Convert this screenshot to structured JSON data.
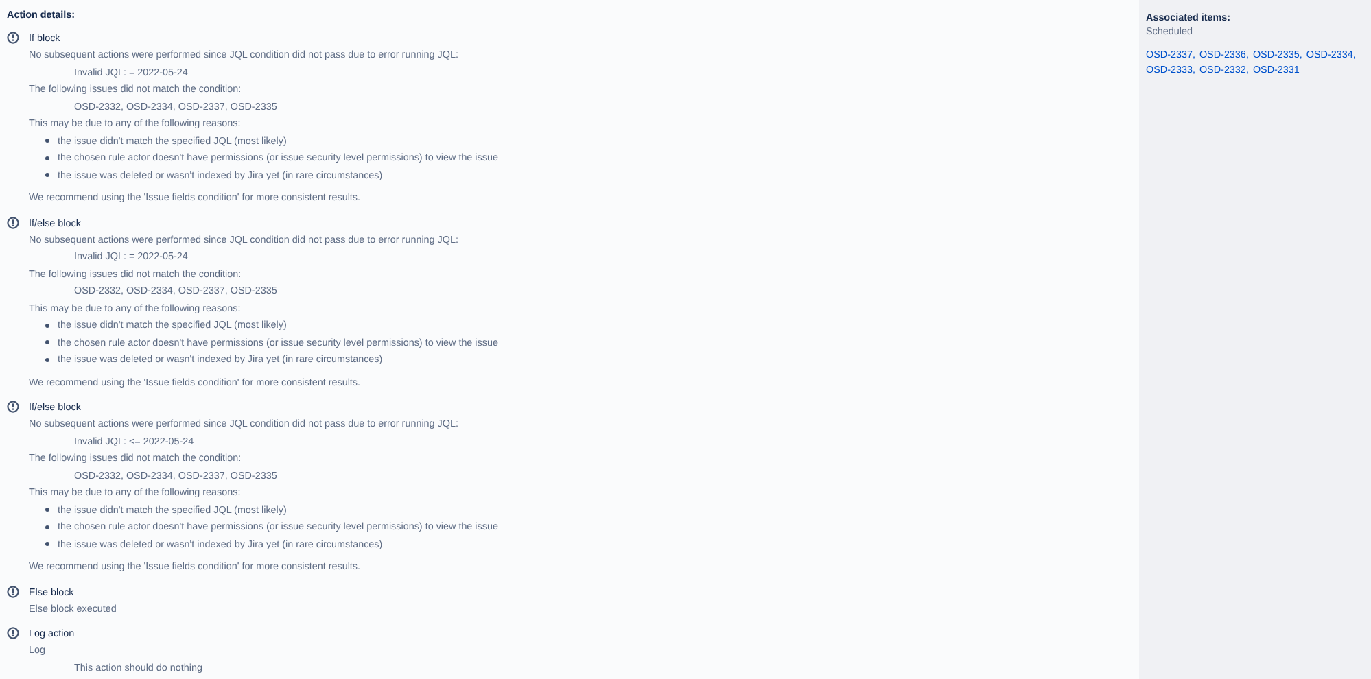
{
  "heading": "Action details:",
  "blocks": [
    {
      "title": "If block",
      "lines": [
        {
          "kind": "text",
          "text": "No subsequent actions were performed since JQL condition did not pass due to error running JQL:"
        },
        {
          "kind": "indented",
          "text": "Invalid JQL: = 2022-05-24"
        },
        {
          "kind": "text",
          "text": "The following issues did not match the condition:"
        },
        {
          "kind": "indented",
          "text": "OSD-2332, OSD-2334, OSD-2337, OSD-2335"
        },
        {
          "kind": "text",
          "text": "This may be due to any of the following reasons:"
        },
        {
          "kind": "bullets",
          "items": [
            "the issue didn't match the specified JQL (most likely)",
            "the chosen rule actor doesn't have permissions (or issue security level permissions) to view the issue",
            "the issue was deleted or wasn't indexed by Jira yet (in rare circumstances)"
          ]
        },
        {
          "kind": "text",
          "text": "We recommend using the 'Issue fields condition' for more consistent results."
        }
      ]
    },
    {
      "title": "If/else block",
      "lines": [
        {
          "kind": "text",
          "text": "No subsequent actions were performed since JQL condition did not pass due to error running JQL:"
        },
        {
          "kind": "indented",
          "text": "Invalid JQL: = 2022-05-24"
        },
        {
          "kind": "text",
          "text": "The following issues did not match the condition:"
        },
        {
          "kind": "indented",
          "text": "OSD-2332, OSD-2334, OSD-2337, OSD-2335"
        },
        {
          "kind": "text",
          "text": "This may be due to any of the following reasons:"
        },
        {
          "kind": "bullets",
          "items": [
            "the issue didn't match the specified JQL (most likely)",
            "the chosen rule actor doesn't have permissions (or issue security level permissions) to view the issue",
            "the issue was deleted or wasn't indexed by Jira yet (in rare circumstances)"
          ]
        },
        {
          "kind": "text",
          "text": "We recommend using the 'Issue fields condition' for more consistent results."
        }
      ]
    },
    {
      "title": "If/else block",
      "lines": [
        {
          "kind": "text",
          "text": "No subsequent actions were performed since JQL condition did not pass due to error running JQL:"
        },
        {
          "kind": "indented",
          "text": "Invalid JQL: <= 2022-05-24"
        },
        {
          "kind": "text",
          "text": "The following issues did not match the condition:"
        },
        {
          "kind": "indented",
          "text": "OSD-2332, OSD-2334, OSD-2337, OSD-2335"
        },
        {
          "kind": "text",
          "text": "This may be due to any of the following reasons:"
        },
        {
          "kind": "bullets",
          "items": [
            "the issue didn't match the specified JQL (most likely)",
            "the chosen rule actor doesn't have permissions (or issue security level permissions) to view the issue",
            "the issue was deleted or wasn't indexed by Jira yet (in rare circumstances)"
          ]
        },
        {
          "kind": "text",
          "text": "We recommend using the 'Issue fields condition' for more consistent results."
        }
      ]
    },
    {
      "title": "Else block",
      "lines": [
        {
          "kind": "text",
          "text": "Else block executed"
        }
      ]
    },
    {
      "title": "Log action",
      "lines": [
        {
          "kind": "text",
          "text": "Log"
        },
        {
          "kind": "indented",
          "text": "This action should do nothing"
        }
      ]
    }
  ],
  "associated": {
    "title": "Associated items:",
    "subtitle": "Scheduled",
    "links": [
      {
        "label": "OSD-2337",
        "separator": ","
      },
      {
        "label": "OSD-2336",
        "separator": ","
      },
      {
        "label": "OSD-2335",
        "separator": ","
      },
      {
        "label": "OSD-2334",
        "separator": ","
      },
      {
        "label": "OSD-2333",
        "separator": ","
      },
      {
        "label": "OSD-2332",
        "separator": ","
      },
      {
        "label": "OSD-2331"
      }
    ]
  }
}
